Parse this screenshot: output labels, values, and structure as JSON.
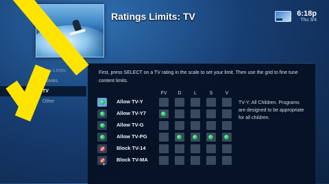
{
  "header": {
    "title": "Ratings Limits: TV",
    "time": "6:18p",
    "date": "Thu 3/4"
  },
  "sidebar": {
    "items": [
      {
        "label": "Ratings Limits",
        "level": "parent",
        "active": false
      },
      {
        "label": "Movies",
        "level": "child",
        "active": false
      },
      {
        "label": "TV",
        "level": "child",
        "active": true
      },
      {
        "label": "Other",
        "level": "child",
        "active": false
      }
    ]
  },
  "panel": {
    "instructions": "First, press SELECT on a TV rating in the scale to set your limit. Then use the grid to fine tune content limits.",
    "columns": [
      "FV",
      "D",
      "L",
      "S",
      "V"
    ],
    "rows": [
      {
        "label": "Allow TV-Y",
        "status": "allow",
        "cells": [
          false,
          false,
          false,
          false,
          false
        ]
      },
      {
        "label": "Allow TV-Y7",
        "status": "allow",
        "cells": [
          true,
          false,
          false,
          false,
          false
        ]
      },
      {
        "label": "Allow TV-G",
        "status": "allow",
        "cells": [
          false,
          false,
          false,
          false,
          false
        ]
      },
      {
        "label": "Allow TV-PG",
        "status": "allow",
        "cells": [
          false,
          true,
          true,
          true,
          true
        ]
      },
      {
        "label": "Block TV-14",
        "status": "block",
        "cells": [
          false,
          false,
          false,
          false,
          false
        ]
      },
      {
        "label": "Block TV-MA",
        "status": "block",
        "cells": [
          false,
          false,
          false,
          false,
          false
        ]
      }
    ],
    "description": "TV-Y: All Children. Programs are designed to be appropriate for all children."
  },
  "colors": {
    "accent_yellow": "#ffe400",
    "allow_green": "#2ecc6e",
    "block_red": "#e05252",
    "panel_bg": "#061224"
  }
}
